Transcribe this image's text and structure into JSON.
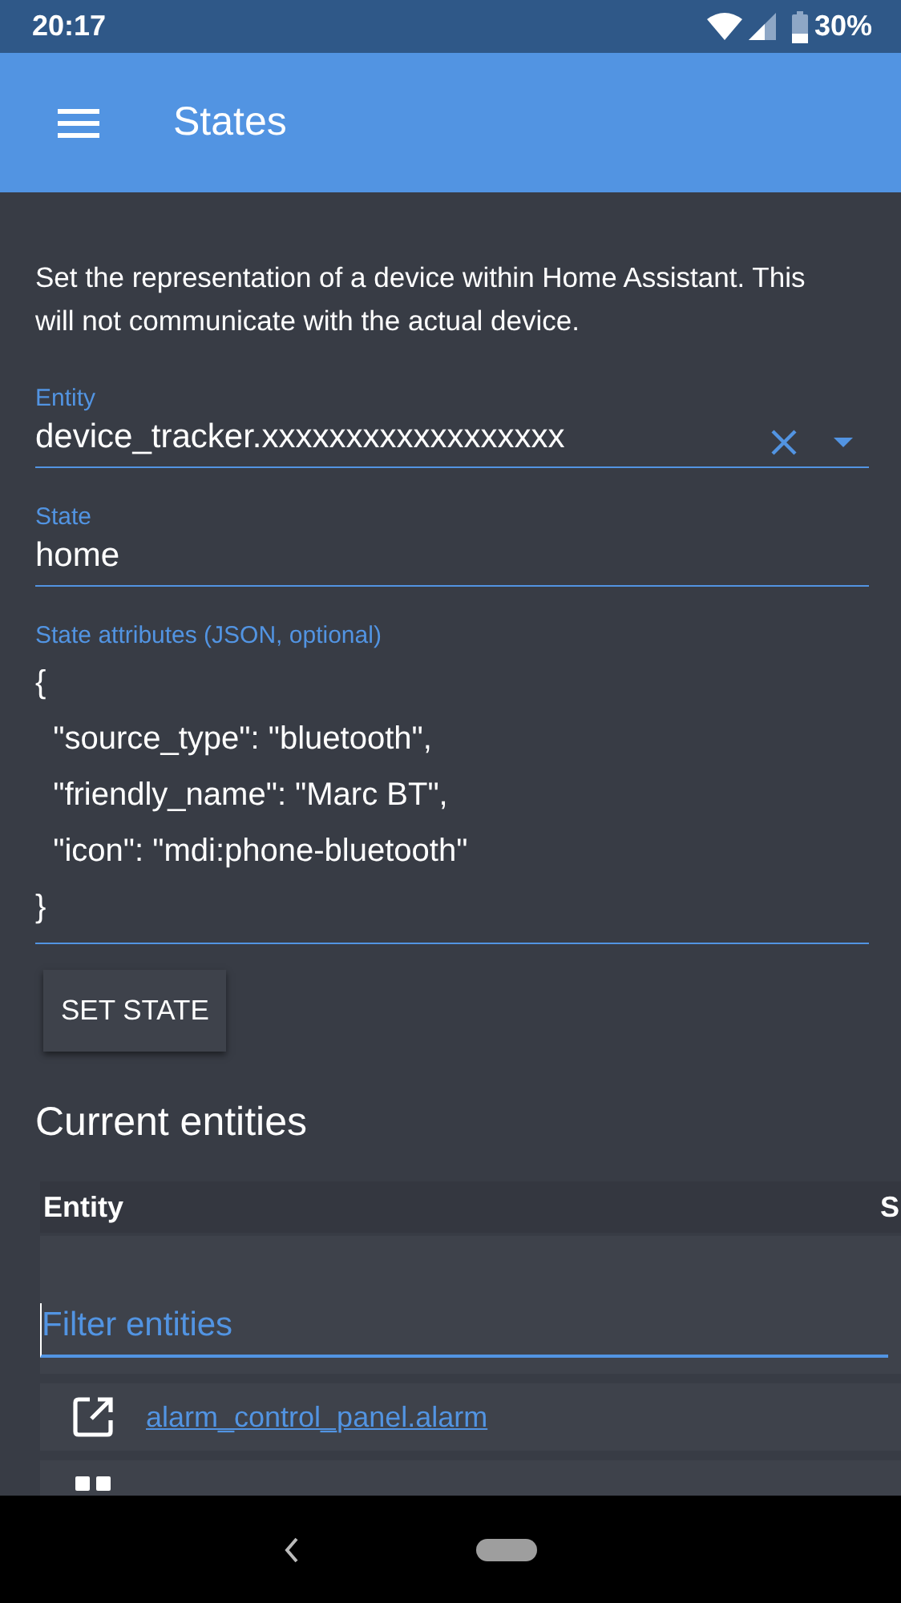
{
  "status_bar": {
    "time": "20:17",
    "battery": "30%"
  },
  "app_bar": {
    "title": "States"
  },
  "description": "Set the representation of a device within Home Assistant. This will not communicate with the actual device.",
  "fields": [
    {
      "kind": "combo",
      "label": "Entity",
      "value": "device_tracker.xxxxxxxxxxxxxxxxxx"
    },
    {
      "kind": "text",
      "label": "State",
      "value": "home"
    },
    {
      "kind": "multiline",
      "label": "State attributes (JSON, optional)",
      "value": "{\n  \"source_type\": \"bluetooth\",\n  \"friendly_name\": \"Marc BT\",\n  \"icon\": \"mdi:phone-bluetooth\"\n}"
    }
  ],
  "set_button": "SET STATE",
  "section_title": "Current entities",
  "table": {
    "columns": [
      "Entity",
      "S"
    ],
    "filter": {
      "placeholder": "Filter entities"
    },
    "rows": [
      {
        "kind": "link",
        "entity": "alarm_control_panel.alarm"
      },
      {
        "kind": "partial"
      }
    ]
  }
}
